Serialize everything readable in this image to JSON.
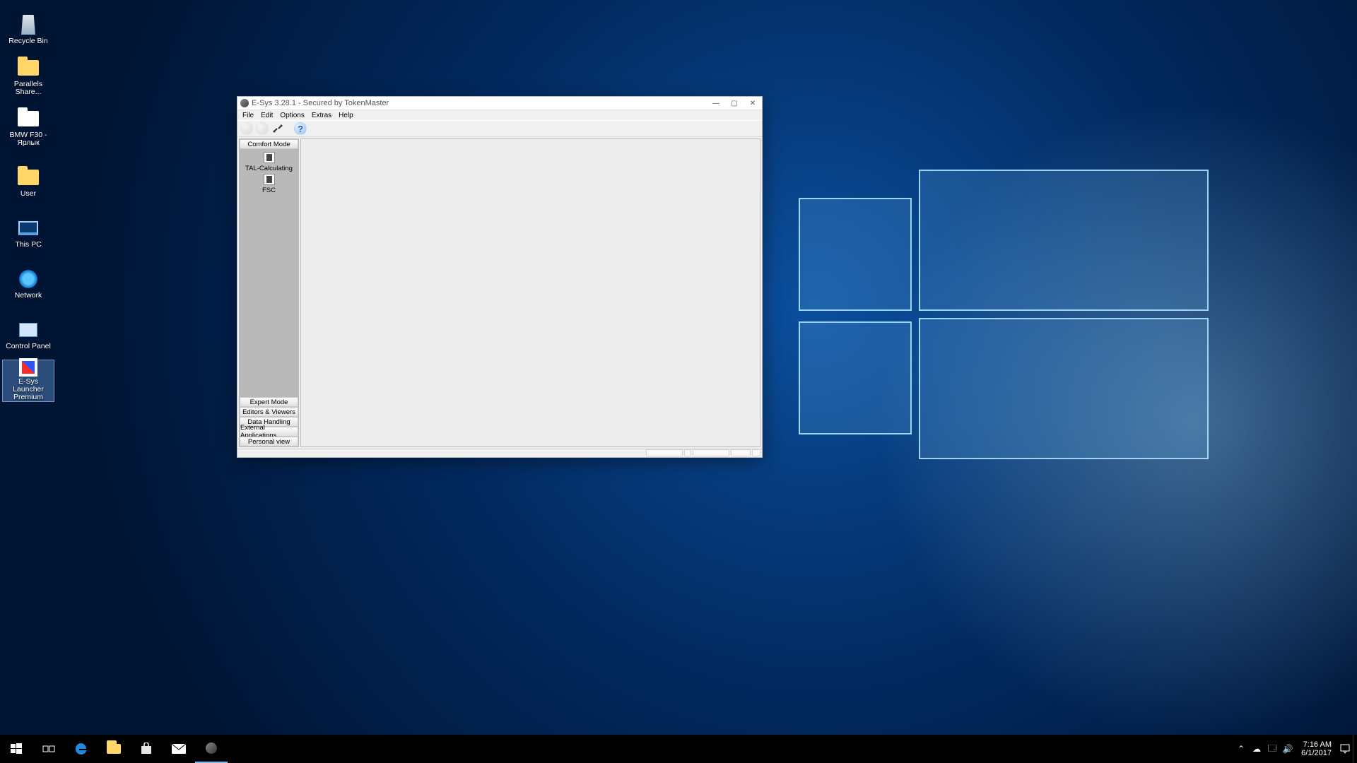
{
  "desktop_icons": [
    {
      "key": "recycle-bin",
      "label": "Recycle Bin"
    },
    {
      "key": "parallels-share",
      "label": "Parallels Share..."
    },
    {
      "key": "bmw-f30",
      "label": "BMW F30 - Ярлык"
    },
    {
      "key": "user",
      "label": "User"
    },
    {
      "key": "this-pc",
      "label": "This PC"
    },
    {
      "key": "network",
      "label": "Network"
    },
    {
      "key": "control-panel",
      "label": "Control Panel"
    },
    {
      "key": "esys-launcher",
      "label": "E-Sys Launcher Premium"
    }
  ],
  "window": {
    "title": "E-Sys 3.28.1 - Secured by TokenMaster",
    "menu": [
      "File",
      "Edit",
      "Options",
      "Extras",
      "Help"
    ],
    "sidebar": {
      "active_header": "Comfort Mode",
      "items": [
        {
          "key": "tal-calculating",
          "label": "TAL-Calculating"
        },
        {
          "key": "fsc",
          "label": "FSC"
        }
      ],
      "collapsed": [
        "Expert Mode",
        "Editors & Viewers",
        "Data Handling",
        "External Applications",
        "Personal view"
      ]
    }
  },
  "taskbar": {
    "time": "7:16 AM",
    "date": "6/1/2017"
  }
}
